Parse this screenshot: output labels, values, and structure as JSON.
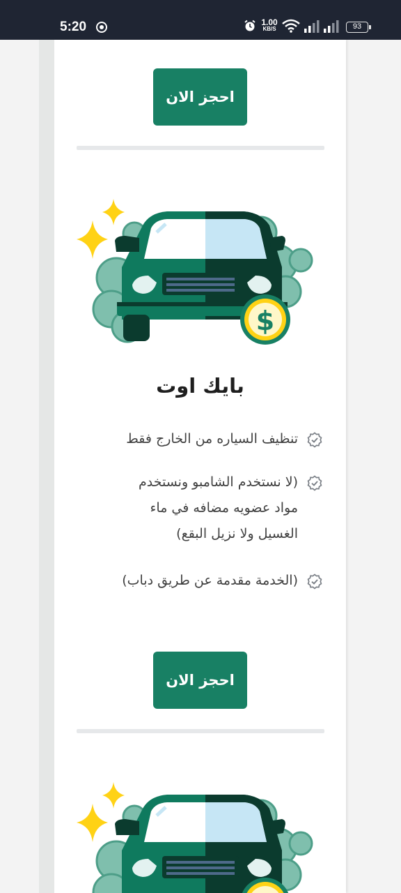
{
  "status_bar": {
    "time": "5:20",
    "net_speed_value": "1.00",
    "net_speed_unit": "KB/S",
    "battery": "93"
  },
  "buttons": {
    "book_now_label": "احجز الان"
  },
  "service": {
    "title": "بايك اوت",
    "features": [
      "تنظيف السياره من الخارج فقط",
      "(لا نستخدم الشامبو ونستخدم مواد عضويه مضافه في ماء الغسيل ولا نزيل البقع)",
      "(الخدمة مقدمة عن طريق دباب)"
    ]
  },
  "colors": {
    "status_bar_bg": "#1f2533",
    "button_green": "#188064",
    "car_green": "#0f7a5e",
    "car_dark": "#0b3b2e",
    "foam": "#7fbfad",
    "sparkle": "#ffd215",
    "coin": "#fff7c8"
  },
  "icons": [
    "alarm-icon",
    "wifi-icon",
    "signal-icon",
    "battery-icon",
    "check-badge-icon",
    "car-wash-illustration",
    "dollar-coin-icon",
    "sparkle-icon"
  ]
}
